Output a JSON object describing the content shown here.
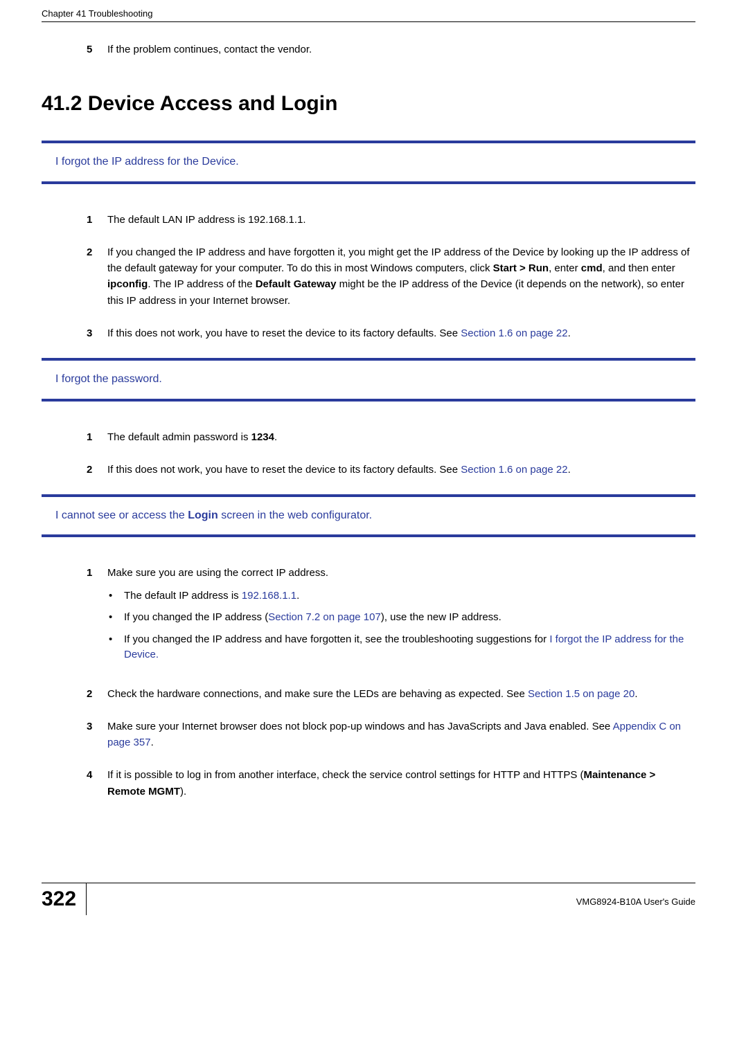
{
  "header": {
    "left": "Chapter 41 Troubleshooting"
  },
  "intro_item": {
    "num": "5",
    "text": "If the problem continues, contact the vendor."
  },
  "section_heading": "41.2  Device Access and Login",
  "issue1": {
    "title": "I forgot the IP address for the Device.",
    "items": [
      {
        "num": "1",
        "parts": [
          {
            "t": "The default LAN IP address is 192.168.1.1."
          }
        ]
      },
      {
        "num": "2",
        "parts": [
          {
            "t": "If you changed the IP address and have forgotten it, you might get the IP address of the Device by looking up the IP address of the default gateway for your computer. To do this in most Windows computers, click "
          },
          {
            "t": "Start > Run",
            "b": true
          },
          {
            "t": ", enter "
          },
          {
            "t": "cmd",
            "b": true
          },
          {
            "t": ", and then enter "
          },
          {
            "t": "ipconfig",
            "b": true
          },
          {
            "t": ". The IP address of the "
          },
          {
            "t": "Default Gateway",
            "b": true
          },
          {
            "t": " might be the IP address of the Device (it depends on the network), so enter this IP address in your Internet browser."
          }
        ]
      },
      {
        "num": "3",
        "parts": [
          {
            "t": "If this does not work, you have to reset the device to its factory defaults. See "
          },
          {
            "t": "Section 1.6 on page 22",
            "l": true
          },
          {
            "t": "."
          }
        ]
      }
    ]
  },
  "issue2": {
    "title": "I forgot the password.",
    "items": [
      {
        "num": "1",
        "parts": [
          {
            "t": "The default admin password is "
          },
          {
            "t": "1234",
            "b": true
          },
          {
            "t": "."
          }
        ]
      },
      {
        "num": "2",
        "parts": [
          {
            "t": "If this does not work, you have to reset the device to its factory defaults. See "
          },
          {
            "t": "Section 1.6 on page 22",
            "l": true
          },
          {
            "t": "."
          }
        ]
      }
    ]
  },
  "issue3": {
    "title_parts": [
      {
        "t": "I cannot see or access the "
      },
      {
        "t": "Login",
        "b": true
      },
      {
        "t": " screen in the web configurator."
      }
    ],
    "items": [
      {
        "num": "1",
        "parts": [
          {
            "t": "Make sure you are using the correct IP address."
          }
        ],
        "bullets": [
          [
            {
              "t": "The default IP address is "
            },
            {
              "t": "192.168.1.1",
              "l": true
            },
            {
              "t": "."
            }
          ],
          [
            {
              "t": "If you changed the IP address ("
            },
            {
              "t": "Section 7.2 on page 107",
              "l": true
            },
            {
              "t": "), use the new IP address."
            }
          ],
          [
            {
              "t": "If you changed the IP address and have forgotten it, see the troubleshooting suggestions for "
            },
            {
              "t": "I forgot the IP address for the Device.",
              "l": true
            }
          ]
        ]
      },
      {
        "num": "2",
        "parts": [
          {
            "t": "Check the hardware connections, and make sure the LEDs are behaving as expected. See "
          },
          {
            "t": "Section 1.5 on page 20",
            "l": true
          },
          {
            "t": "."
          }
        ]
      },
      {
        "num": "3",
        "parts": [
          {
            "t": "Make sure your Internet browser does not block pop-up windows and has JavaScripts and Java enabled. See "
          },
          {
            "t": "Appendix C on page 357",
            "l": true
          },
          {
            "t": "."
          }
        ]
      },
      {
        "num": "4",
        "parts": [
          {
            "t": "If it is possible to log in from another interface, check the service control settings for HTTP and HTTPS ("
          },
          {
            "t": "Maintenance > Remote MGMT",
            "b": true
          },
          {
            "t": ")."
          }
        ]
      }
    ]
  },
  "footer": {
    "page": "322",
    "guide": "VMG8924-B10A User's Guide"
  }
}
